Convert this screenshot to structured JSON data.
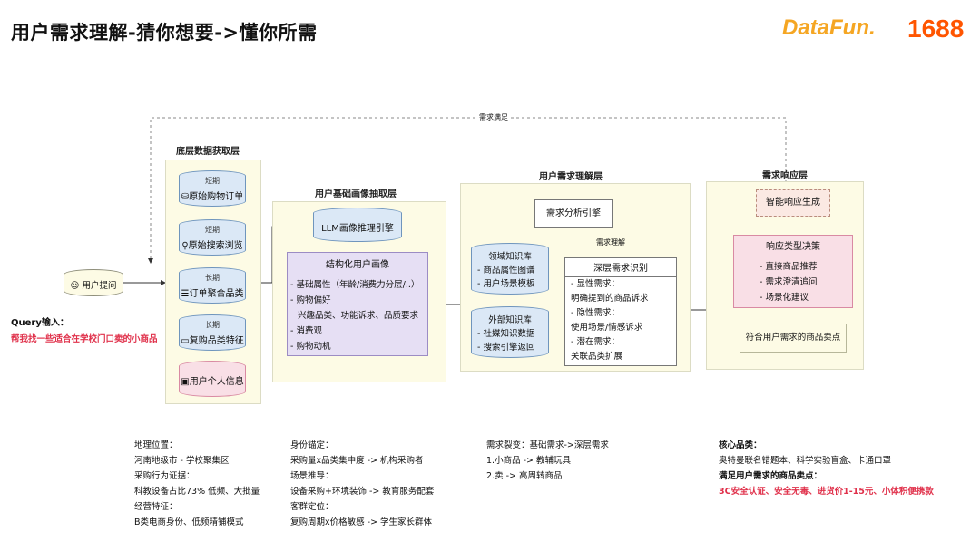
{
  "header": {
    "title": "用户需求理解-猜你想要->懂你所需",
    "logo_datafun": "DataFun.",
    "logo_1688": "1688"
  },
  "diagram": {
    "feedback_label": "需求满足",
    "user_query": "用户提问",
    "query_input": {
      "label": "Query输入：",
      "text": "帮我找一些适合在学校门口卖的小商品"
    },
    "bottom_layer": {
      "title": "底层数据获取层",
      "items": [
        {
          "tag": "短期",
          "label": "原始购物订单"
        },
        {
          "tag": "短期",
          "label": "原始搜索浏览"
        },
        {
          "tag": "长期",
          "label": "订单聚合品类"
        },
        {
          "tag": "长期",
          "label": "复购品类特征"
        },
        {
          "tag": "",
          "label": "用户个人信息"
        }
      ]
    },
    "profile_layer": {
      "title": "用户基础画像抽取层",
      "engine": "LLM画像推理引擎",
      "profile_title": "结构化用户画像",
      "profile_items": [
        "- 基础属性（年龄/消费力分层/..）",
        "- 购物偏好",
        "  兴趣品类、功能诉求、品质要求",
        "- 消费观",
        "- 购物动机"
      ]
    },
    "understanding_layer": {
      "title": "用户需求理解层",
      "engine": "需求分析引擎",
      "understand_tag": "需求理解",
      "domain_kb": {
        "title": "领域知识库",
        "items": [
          "- 商品属性图谱",
          "- 用户场景模板"
        ]
      },
      "external_kb": {
        "title": "外部知识库",
        "items": [
          "- 社媒知识数据",
          "- 搜索引擎返回"
        ]
      },
      "deep": {
        "title": "深层需求识别",
        "items": [
          "- 显性需求：",
          "明确提到的商品诉求",
          "- 隐性需求：",
          "使用场景/情感诉求",
          "- 潜在需求：",
          "关联品类扩展"
        ]
      }
    },
    "response_layer": {
      "title": "需求响应层",
      "engine": "智能响应生成",
      "decision_title": "响应类型决策",
      "decision_items": [
        "- 直接商品推荐",
        "- 需求澄清追问",
        "- 场景化建议"
      ],
      "output": "符合用户需求的商品卖点"
    }
  },
  "notes": {
    "col1": [
      "地理位置：",
      "河南地级市 - 学校聚集区",
      "采购行为证据：",
      " 科教设备占比73% 低频、大批量",
      "经营特征：",
      "B类电商身份、低频精铺模式"
    ],
    "col2": [
      "身份锚定：",
      "采购量x品类集中度  ->  机构采购者",
      "场景推导：",
      "设备采购+环境装饰  ->  教育服务配套",
      "客群定位：",
      " 复购周期x价格敏感  ->  学生家长群体"
    ],
    "col3": [
      "需求裂变：基础需求->深层需求",
      "1.小商品 -> 教辅玩具",
      "2.卖 -> 高周转商品"
    ],
    "col4": {
      "core_label": "核心品类：",
      "core_text": "奥特曼联名错题本、科学实验盲盒、卡通口罩",
      "selling_label": "满足用户需求的商品卖点：",
      "selling_text": "3C安全认证、安全无毒、进货价1-15元、小体积便携款"
    }
  }
}
